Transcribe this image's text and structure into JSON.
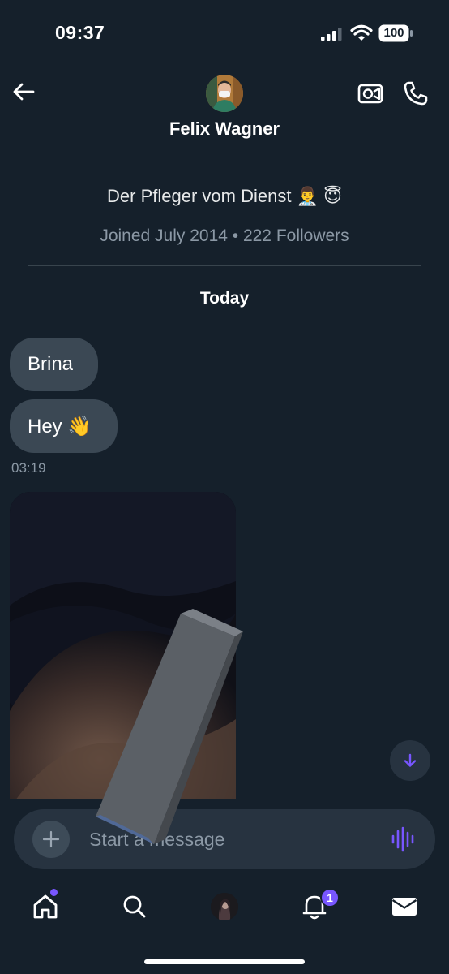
{
  "status_bar": {
    "time": "09:37",
    "battery": "100"
  },
  "header": {
    "name": "Felix Wagner",
    "back_icon": "arrow-left-icon",
    "video_icon": "video-camera-icon",
    "phone_icon": "phone-icon"
  },
  "profile": {
    "bio": "Der Pfleger vom Dienst 👨‍⚕️ 😇",
    "meta": "Joined July 2014 • 222 Followers"
  },
  "conversation": {
    "day_label": "Today",
    "messages": [
      {
        "text": "Brina"
      },
      {
        "text": "Hey 👋"
      }
    ],
    "timestamp": "03:19"
  },
  "composer": {
    "placeholder": "Start a message"
  },
  "nav": {
    "notifications_badge": "1"
  },
  "colors": {
    "background": "#15202b",
    "bubble": "#3b4854",
    "accent": "#7856ff",
    "muted_text": "#8b98a5"
  }
}
